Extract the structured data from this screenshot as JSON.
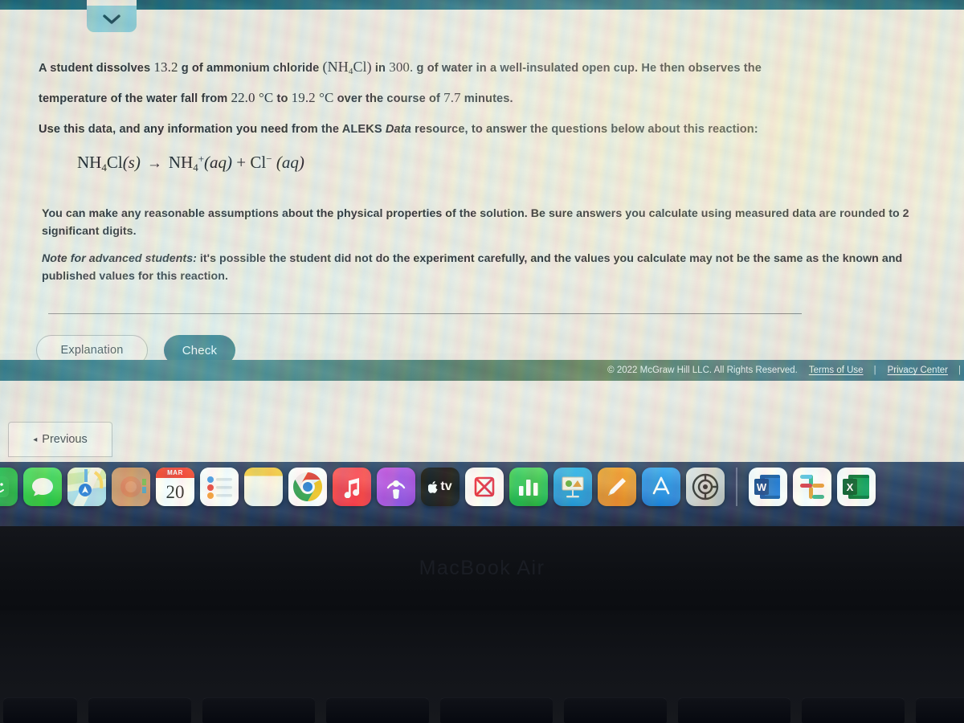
{
  "browser": {
    "chevron_icon": "chevron-down-icon"
  },
  "problem": {
    "line1_part1": "A student dissolves ",
    "value_mass": "13.2",
    "line1_part2": " g of ammonium chloride ",
    "formula_inline": "(NH4Cl)",
    "line1_part3": " in ",
    "value_water": "300.",
    "line1_part4": " g of water in a well-insulated open cup. He then observes the",
    "line2_part1": "temperature of the water fall from ",
    "temp_initial": "22.0 °C",
    "line2_part2": " to ",
    "temp_final": "19.2 °C",
    "line2_part3": " over the course of ",
    "duration": "7.7",
    "line2_part4": " minutes.",
    "line3_part1": "Use this data, and any information you need from the ALEKS ",
    "line3_italic": "Data",
    "line3_part2": " resource, to answer the questions below about this reaction:",
    "equation": {
      "reactant": "NH4Cl(s)",
      "arrow": "→",
      "product1": "NH4+(aq)",
      "plus": "+",
      "product2": "Cl− (aq)"
    },
    "paragraph_assumptions": "You can make any reasonable assumptions about the physical properties of the solution. Be sure answers you calculate using measured data are rounded to 2 significant digits.",
    "note_label": "Note for advanced students:",
    "note_body": " it's possible the student did not do the experiment carefully, and the values you calculate may not be the same as the known and published values for this reaction."
  },
  "actions": {
    "explanation_label": "Explanation",
    "check_label": "Check",
    "previous_label": "Previous",
    "previous_arrow": "◂"
  },
  "footer": {
    "copyright": "© 2022 McGraw Hill LLC. All Rights Reserved.",
    "terms_label": "Terms of Use",
    "separator": "|",
    "privacy_label": "Privacy Center",
    "separator2": "|"
  },
  "dock": {
    "apps": [
      {
        "name": "finder",
        "label": ""
      },
      {
        "name": "messages",
        "label": ""
      },
      {
        "name": "maps",
        "label": ""
      },
      {
        "name": "photos",
        "label": ""
      },
      {
        "name": "calendar",
        "label": "20",
        "month": "MAR"
      },
      {
        "name": "reminders",
        "label": ""
      },
      {
        "name": "notes",
        "label": ""
      },
      {
        "name": "chrome",
        "label": ""
      },
      {
        "name": "music",
        "label": ""
      },
      {
        "name": "podcasts",
        "label": ""
      },
      {
        "name": "apple-tv",
        "label": "tv"
      },
      {
        "name": "news",
        "label": ""
      },
      {
        "name": "numbers",
        "label": ""
      },
      {
        "name": "keynote",
        "label": ""
      },
      {
        "name": "pages",
        "label": ""
      },
      {
        "name": "app-store",
        "label": ""
      },
      {
        "name": "system-preferences",
        "label": ""
      },
      {
        "name": "microsoft-word",
        "label": "W"
      },
      {
        "name": "slack",
        "label": ""
      },
      {
        "name": "microsoft-excel",
        "label": "X"
      }
    ]
  },
  "hardware": {
    "brand": "MacBook Air"
  }
}
